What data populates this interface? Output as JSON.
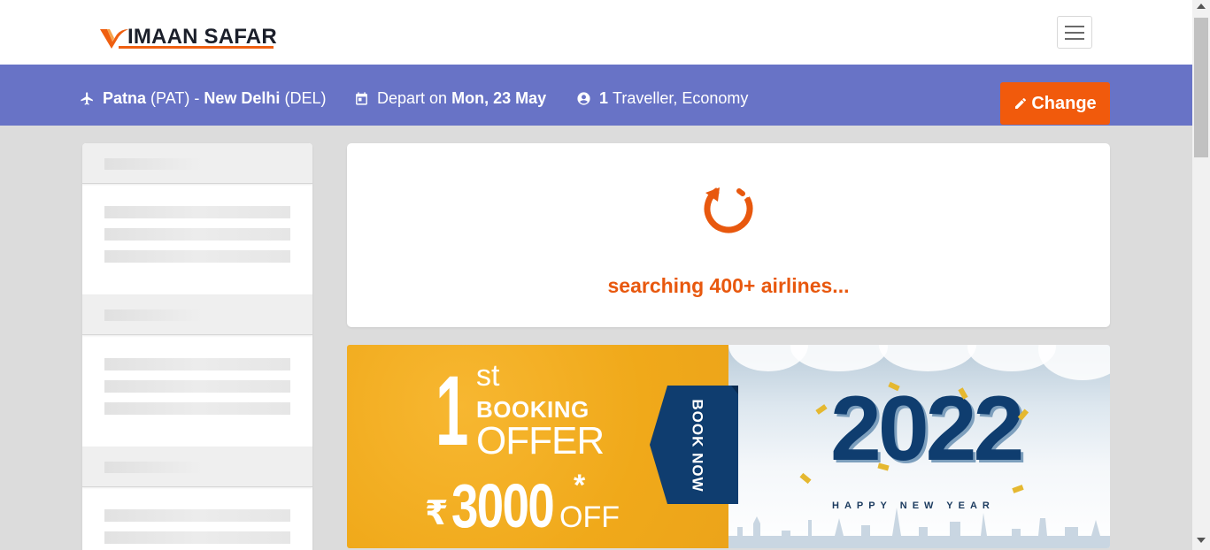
{
  "header": {
    "logo_mark": "V",
    "logo_text": "IMAAN SAFAR",
    "menu_button": "menu"
  },
  "search_summary": {
    "origin_city": "Patna",
    "origin_code": "(PAT)",
    "separator": "-",
    "destination_city": "New Delhi",
    "destination_code": "(DEL)",
    "depart_label": "Depart on",
    "depart_date": "Mon, 23 May",
    "traveller_count": "1",
    "traveller_text": "Traveller, Economy",
    "change_label": "Change",
    "icons": [
      "plane-icon",
      "calendar-icon",
      "user-circle-icon",
      "pencil-icon"
    ]
  },
  "loading": {
    "message": "searching 400+ airlines..."
  },
  "banner": {
    "one": "1",
    "ordinal": "st",
    "booking": "BOOKING",
    "offer": "OFFER",
    "rupee": "₹",
    "amount": "3000",
    "asterisk": "*",
    "off": "OFF",
    "book_now": "BOOK NOW",
    "year": "2022",
    "greeting": "HAPPY NEW YEAR"
  },
  "colors": {
    "accent": "#f15a0c",
    "summary_bar": "#6873c6",
    "banner_yellow": "#f0a91a",
    "banner_navy": "#0f3d6f"
  }
}
